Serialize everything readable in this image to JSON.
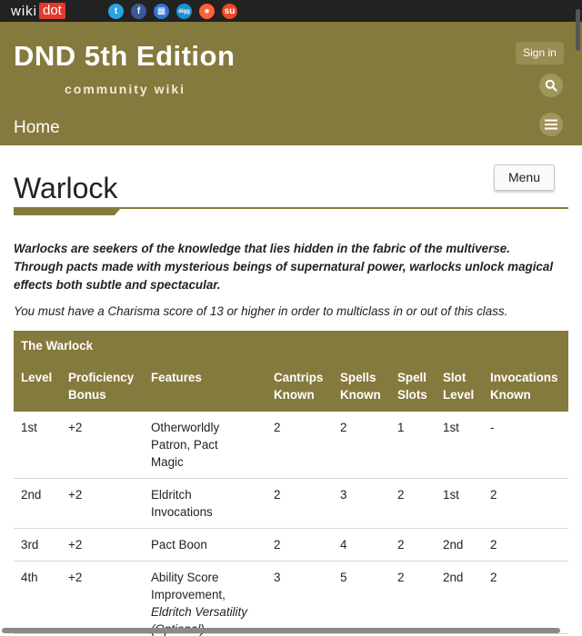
{
  "topbar": {
    "logo_wiki": "wiki",
    "logo_dot": "dot",
    "shares": [
      {
        "name": "twitter-icon",
        "glyph": "t",
        "color": "#2aa3e0"
      },
      {
        "name": "facebook-icon",
        "glyph": "f",
        "color": "#3b5998"
      },
      {
        "name": "delicious-icon",
        "glyph": "▦",
        "color": "#3274d1"
      },
      {
        "name": "digg-icon",
        "glyph": "digg",
        "color": "#1d8fd1"
      },
      {
        "name": "reddit-icon",
        "glyph": "●",
        "color": "#ff5f3d"
      },
      {
        "name": "stumbleupon-icon",
        "glyph": "su",
        "color": "#eb4924"
      }
    ]
  },
  "header": {
    "title": "DND 5th Edition",
    "subtitle": "community wiki",
    "signin_label": "Sign in",
    "nav_home": "Home",
    "search_icon": "search-icon",
    "menu_icon": "hamburger-icon"
  },
  "page": {
    "menu_label": "Menu",
    "title": "Warlock",
    "intro": "Warlocks are seekers of the knowledge that lies hidden in the fabric of the multiverse. Through pacts made with mysterious beings of supernatural power, warlocks unlock magical effects both subtle and spectacular.",
    "note": "You must have a Charisma score of 13 or higher in order to multiclass in or out of this class."
  },
  "table": {
    "caption": "The Warlock",
    "headers": [
      [
        "Level"
      ],
      [
        "Proficiency",
        "Bonus"
      ],
      [
        "Features"
      ],
      [
        "Cantrips",
        "Known"
      ],
      [
        "Spells",
        "Known"
      ],
      [
        "Spell",
        "Slots"
      ],
      [
        "Slot",
        "Level"
      ],
      [
        "Invocations",
        "Known"
      ]
    ],
    "rows": [
      {
        "level": "1st",
        "prof": "+2",
        "features": [
          "Otherworldly",
          "Patron, Pact",
          "Magic"
        ],
        "features_italic": [],
        "cantrips": "2",
        "spells": "2",
        "slots": "1",
        "slot_level": "1st",
        "invocations": "-"
      },
      {
        "level": "2nd",
        "prof": "+2",
        "features": [
          "Eldritch",
          "Invocations"
        ],
        "features_italic": [],
        "cantrips": "2",
        "spells": "3",
        "slots": "2",
        "slot_level": "1st",
        "invocations": "2"
      },
      {
        "level": "3rd",
        "prof": "+2",
        "features": [
          "Pact Boon"
        ],
        "features_italic": [],
        "cantrips": "2",
        "spells": "4",
        "slots": "2",
        "slot_level": "2nd",
        "invocations": "2"
      },
      {
        "level": "4th",
        "prof": "+2",
        "features": [
          "Ability Score",
          "Improvement,"
        ],
        "features_italic": [
          "Eldritch Versatility",
          "(Optional)"
        ],
        "cantrips": "3",
        "spells": "5",
        "slots": "2",
        "slot_level": "2nd",
        "invocations": "2"
      }
    ]
  },
  "colors": {
    "brand": "#857a3d",
    "topbar": "#222222",
    "logo_red": "#e23a2e"
  }
}
